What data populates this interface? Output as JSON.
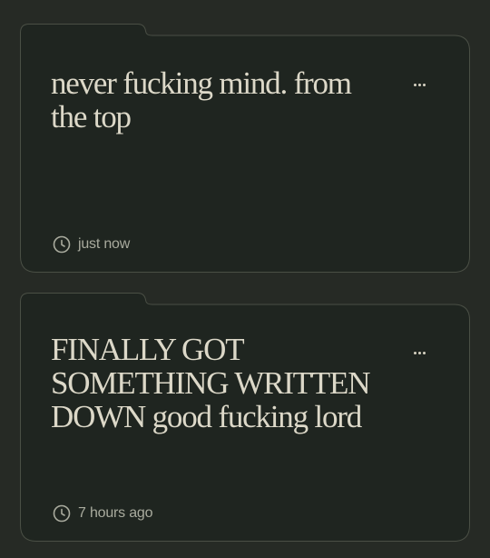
{
  "notes": [
    {
      "title": "never fucking mind. from the top",
      "time": "just now",
      "more_icon": "more-horizontal-icon",
      "time_icon": "clock-icon"
    },
    {
      "title": "FINALLY GOT SOMETHING WRITTEN DOWN good fucking lord",
      "time": "7 hours ago",
      "more_icon": "more-horizontal-icon",
      "time_icon": "clock-icon"
    }
  ],
  "colors": {
    "background": "#262a25",
    "card": "#1f2520",
    "card_border": "#4a4f45",
    "title_text": "#dcd8c8",
    "meta_text": "#a9ab9e"
  }
}
